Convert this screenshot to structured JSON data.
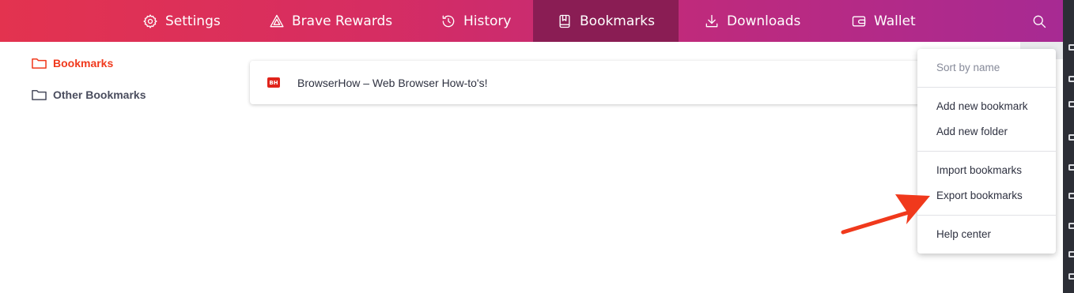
{
  "nav": {
    "settings": "Settings",
    "rewards": "Brave Rewards",
    "history": "History",
    "bookmarks": "Bookmarks",
    "downloads": "Downloads",
    "wallet": "Wallet",
    "search_icon": "search-icon"
  },
  "sidebar": {
    "items": [
      {
        "label": "Bookmarks",
        "active": true,
        "icon": "folder-icon"
      },
      {
        "label": "Other Bookmarks",
        "active": false,
        "icon": "folder-icon"
      }
    ]
  },
  "bookmarks": [
    {
      "favicon_text": "BH",
      "title": "BrowserHow – Web Browser How-to's!"
    }
  ],
  "menu": {
    "sort": "Sort by name",
    "add_bookmark": "Add new bookmark",
    "add_folder": "Add new folder",
    "import": "Import bookmarks",
    "export": "Export bookmarks",
    "help": "Help center"
  },
  "colors": {
    "accent": "#f0391c",
    "nav_active": "#8a1d54",
    "arrow": "#f0391c"
  }
}
